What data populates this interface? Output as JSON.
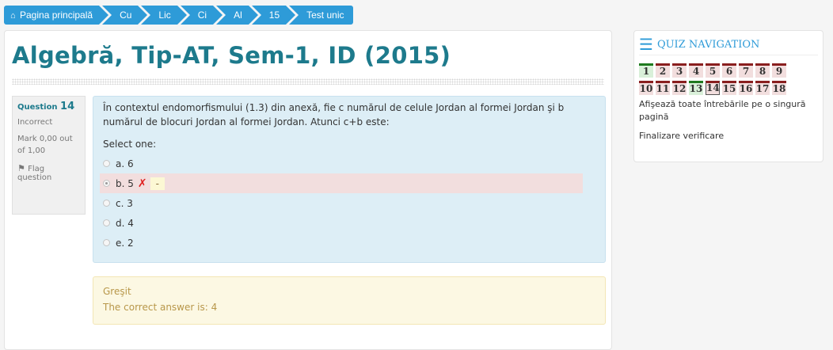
{
  "breadcrumb": {
    "home_icon": "home-icon",
    "items": [
      "Pagina principală",
      "Cu",
      "Lic",
      "Ci",
      "Al",
      "15",
      "Test unic"
    ]
  },
  "page": {
    "title": "Algebră, Tip-AT, Sem-1, ID (2015)"
  },
  "question": {
    "label": "Question",
    "number": "14",
    "state": "Incorrect",
    "grade": "Mark 0,00 out of 1,00",
    "flag_label": "Flag question",
    "text": "În contextul endomorfismului (1.3) din anexă, fie c numărul de celule Jordan al formei Jordan şi b numărul de blocuri Jordan al formei Jordan. Atunci c+b este:",
    "prompt": "Select one:",
    "answers": [
      {
        "label": "a. 6",
        "selected": false
      },
      {
        "label": "b. 5",
        "selected": true,
        "mark": "-"
      },
      {
        "label": "c. 3",
        "selected": false
      },
      {
        "label": "d. 4",
        "selected": false
      },
      {
        "label": "e. 2",
        "selected": false
      }
    ]
  },
  "feedback": {
    "status": "Greşit",
    "correct_answer": "The correct answer is: 4"
  },
  "navigation": {
    "title": "QUIZ NAVIGATION",
    "rows": [
      [
        {
          "n": "1",
          "state": "correct"
        },
        {
          "n": "2",
          "state": "incorrect"
        },
        {
          "n": "3",
          "state": "incorrect"
        },
        {
          "n": "4",
          "state": "incorrect"
        },
        {
          "n": "5",
          "state": "incorrect"
        },
        {
          "n": "6",
          "state": "incorrect"
        },
        {
          "n": "7",
          "state": "incorrect"
        },
        {
          "n": "8",
          "state": "incorrect"
        },
        {
          "n": "9",
          "state": "incorrect"
        }
      ],
      [
        {
          "n": "10",
          "state": "incorrect"
        },
        {
          "n": "11",
          "state": "incorrect"
        },
        {
          "n": "12",
          "state": "incorrect"
        },
        {
          "n": "13",
          "state": "correct"
        },
        {
          "n": "14",
          "state": "current"
        },
        {
          "n": "15",
          "state": "incorrect"
        },
        {
          "n": "16",
          "state": "incorrect"
        },
        {
          "n": "17",
          "state": "incorrect"
        },
        {
          "n": "18",
          "state": "incorrect"
        }
      ]
    ],
    "show_all_link": "Afişează toate întrebările pe o singură pagină",
    "finish_link": "Finalizare verificare"
  },
  "colors": {
    "accent": "#2e9bd8",
    "title": "#1d7a8c",
    "incorrect_bg": "#f2dede",
    "correct_bg": "#d9f0d9"
  }
}
